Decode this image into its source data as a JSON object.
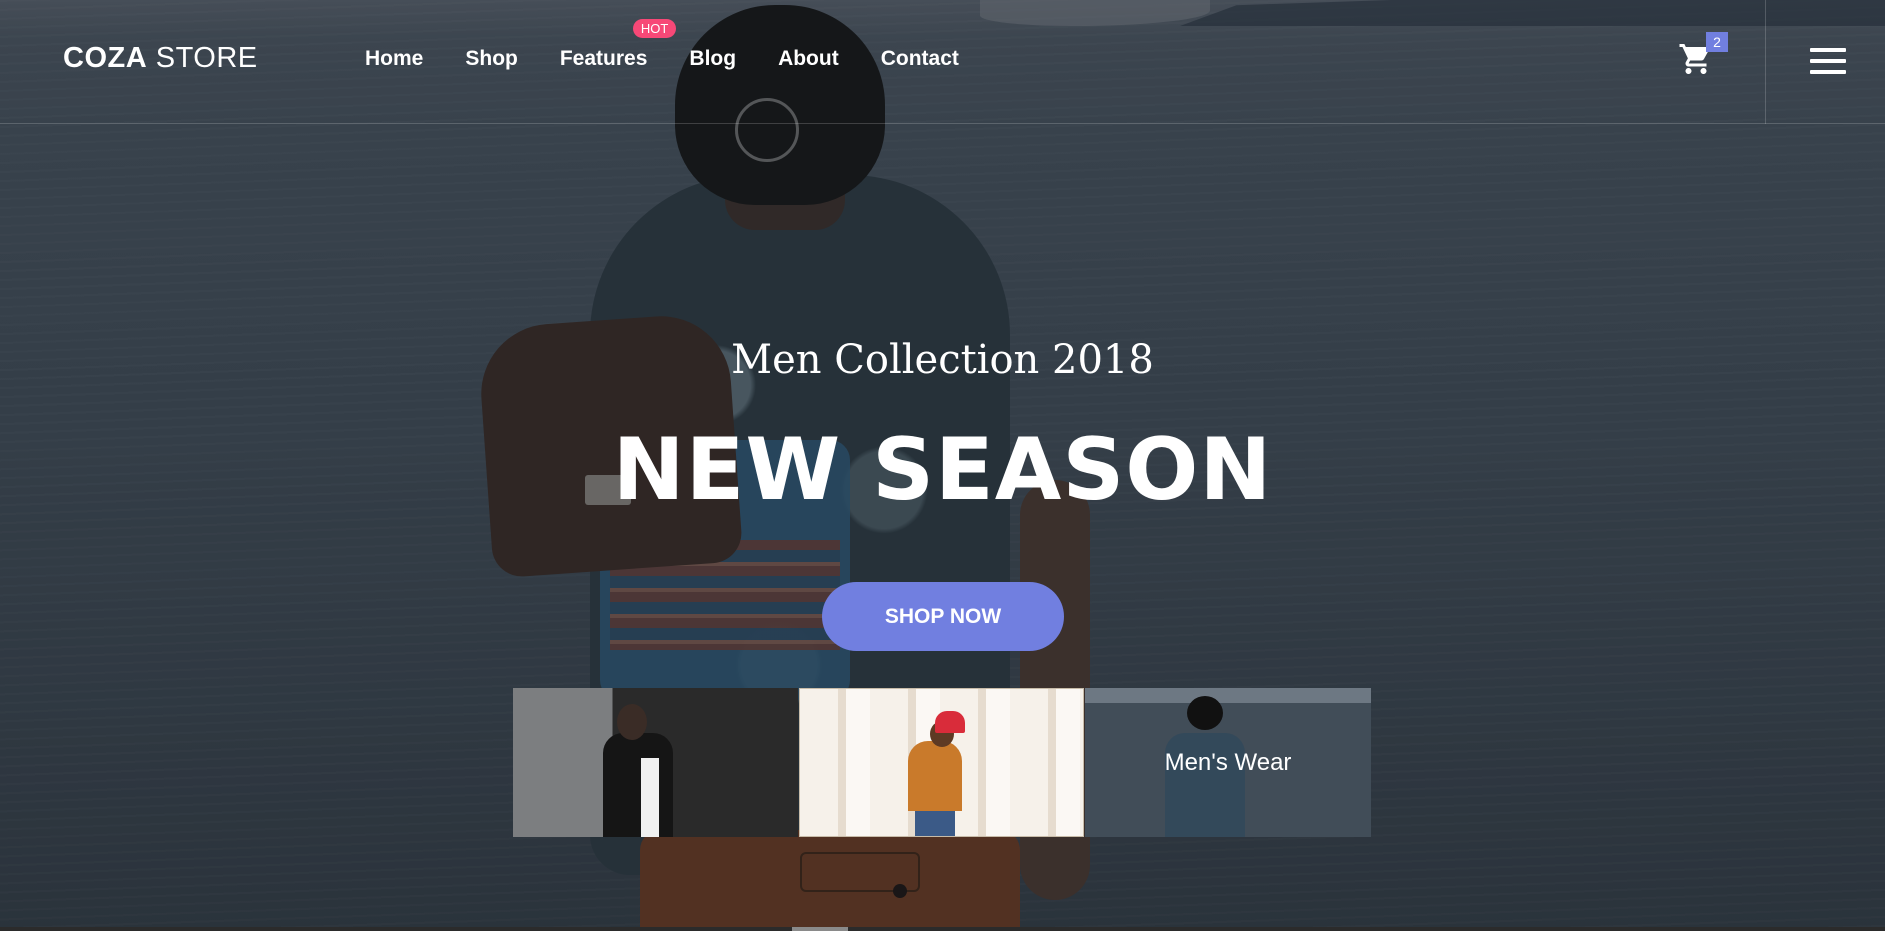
{
  "header": {
    "logo_bold": "COZA",
    "logo_light": "STORE",
    "nav": [
      {
        "label": "Home"
      },
      {
        "label": "Shop"
      },
      {
        "label": "Features",
        "badge": "HOT"
      },
      {
        "label": "Blog"
      },
      {
        "label": "About"
      },
      {
        "label": "Contact"
      }
    ],
    "cart_count": "2",
    "cart_icon": "cart-icon",
    "menu_icon": "hamburger-menu-icon"
  },
  "hero": {
    "subtitle": "Men Collection 2018",
    "headline": "NEW SEASON",
    "cta_label": "SHOP NOW"
  },
  "thumbnails": [
    {
      "label": ""
    },
    {
      "label": ""
    },
    {
      "label": "Men's Wear"
    }
  ],
  "colors": {
    "accent": "#717fe0",
    "hot_badge": "#f74877",
    "text": "#ffffff"
  }
}
